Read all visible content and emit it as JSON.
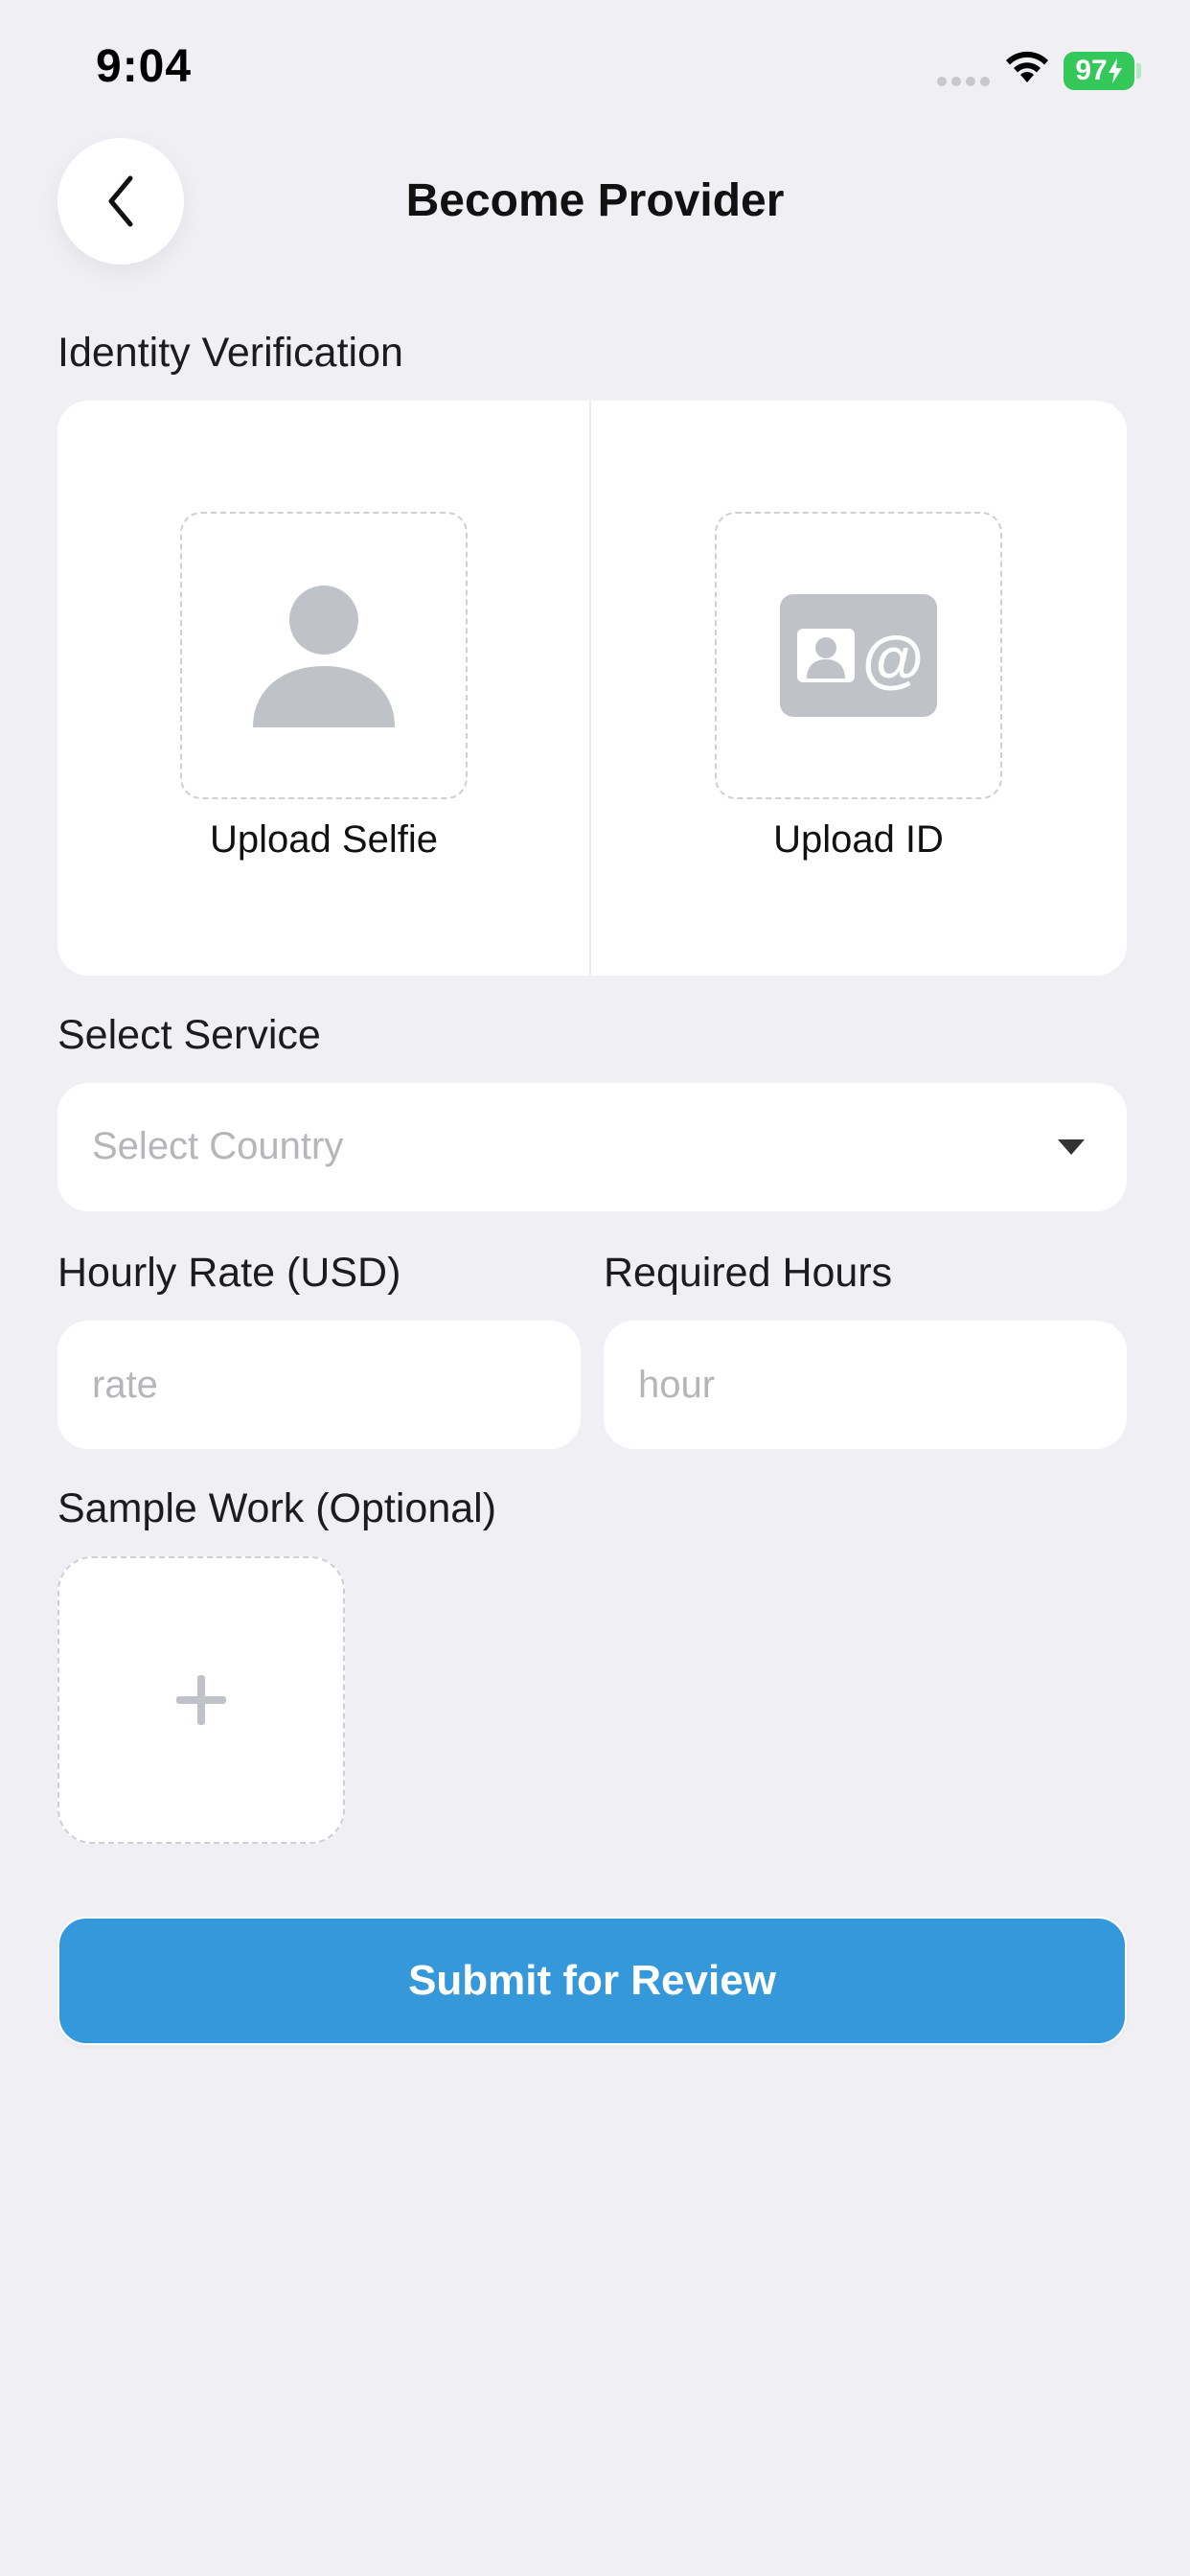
{
  "status_bar": {
    "time": "9:04",
    "battery": "97"
  },
  "header": {
    "title": "Become Provider",
    "back_icon": "chevron-left-icon"
  },
  "identity": {
    "label": "Identity Verification",
    "selfie_label": "Upload Selfie",
    "selfie_icon": "person-icon",
    "id_label": "Upload ID",
    "id_icon": "id-card-icon"
  },
  "service": {
    "label": "Select Service",
    "placeholder": "Select Country",
    "dropdown_icon": "caret-down-icon"
  },
  "rate": {
    "label": "Hourly Rate (USD)",
    "placeholder": "rate",
    "value": ""
  },
  "hours": {
    "label": "Required Hours",
    "placeholder": "hour",
    "value": ""
  },
  "sample": {
    "label": "Sample Work (Optional)",
    "add_icon": "plus-icon"
  },
  "submit": {
    "label": "Submit for Review"
  },
  "colors": {
    "accent": "#3598db",
    "background": "#f0f0f4",
    "icon_gray": "#bfc3c7",
    "battery": "#34c759"
  }
}
